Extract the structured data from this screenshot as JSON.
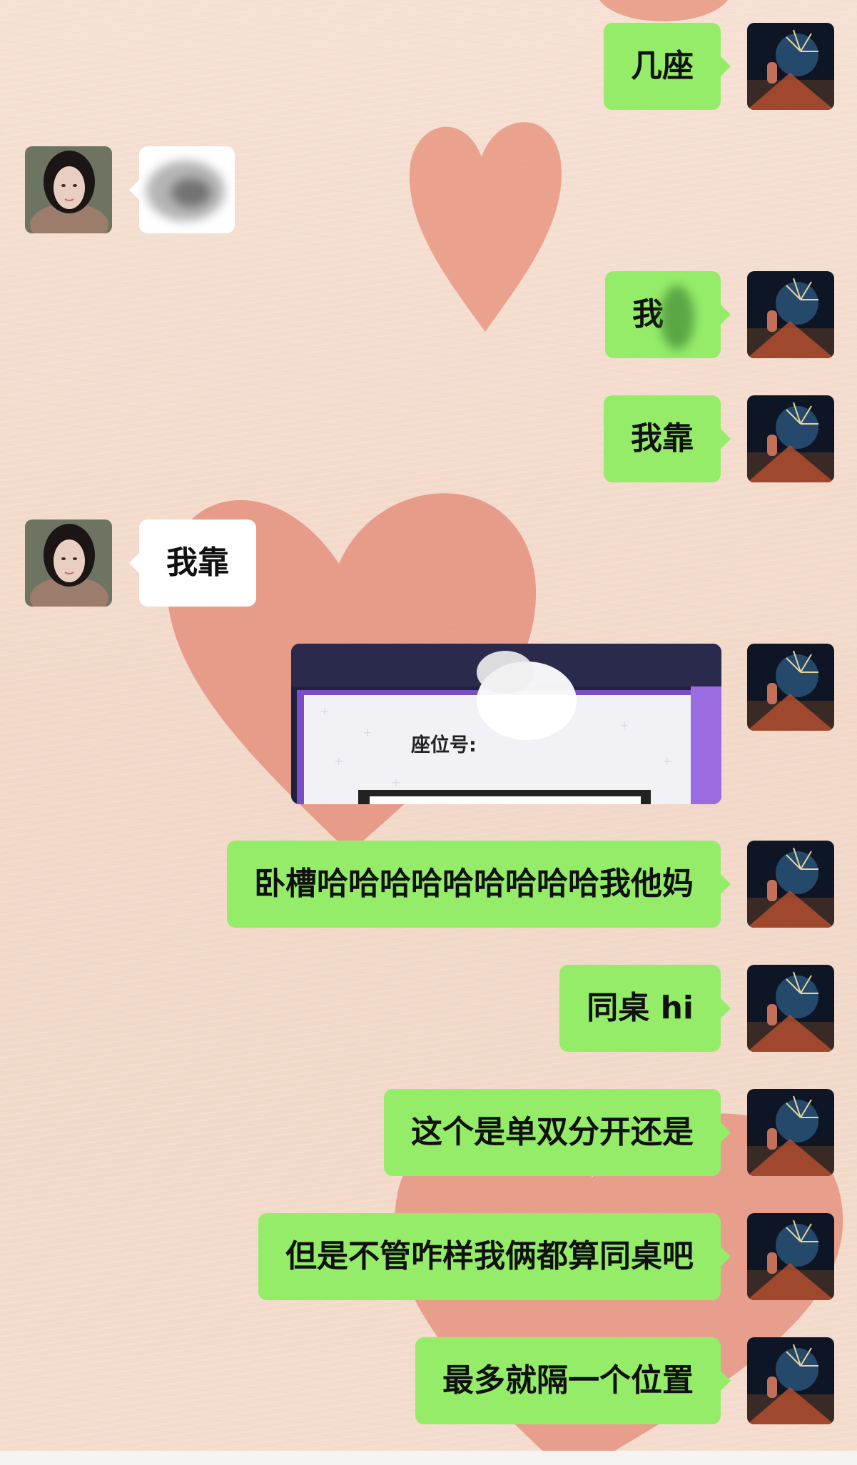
{
  "chat": {
    "messages": [
      {
        "side": "out",
        "type": "text",
        "text": "几座"
      },
      {
        "side": "in",
        "type": "text",
        "text": "",
        "note_hidden": true
      },
      {
        "side": "out",
        "type": "text",
        "text": "我"
      },
      {
        "side": "out",
        "type": "text",
        "text": "我靠"
      },
      {
        "side": "in",
        "type": "text",
        "text": "我靠"
      },
      {
        "side": "out",
        "type": "image",
        "text": "座位号:"
      },
      {
        "side": "out",
        "type": "text",
        "text": "卧槽哈哈哈哈哈哈哈哈哈我他妈"
      },
      {
        "side": "out",
        "type": "text",
        "text": "同桌 hi"
      },
      {
        "side": "out",
        "type": "text",
        "text": "这个是单双分开还是"
      },
      {
        "side": "out",
        "type": "text",
        "text": "但是不管咋样我俩都算同桌吧"
      },
      {
        "side": "out",
        "type": "text",
        "text": "最多就隔一个位置"
      }
    ]
  },
  "colors": {
    "outgoing_bubble": "#95ec69",
    "incoming_bubble": "#ffffff",
    "background": "#f4ddcf",
    "heart": "#e9957f"
  },
  "icons": {
    "self_avatar": "fireworks-night-avatar",
    "peer_avatar": "girl-portrait-avatar"
  }
}
